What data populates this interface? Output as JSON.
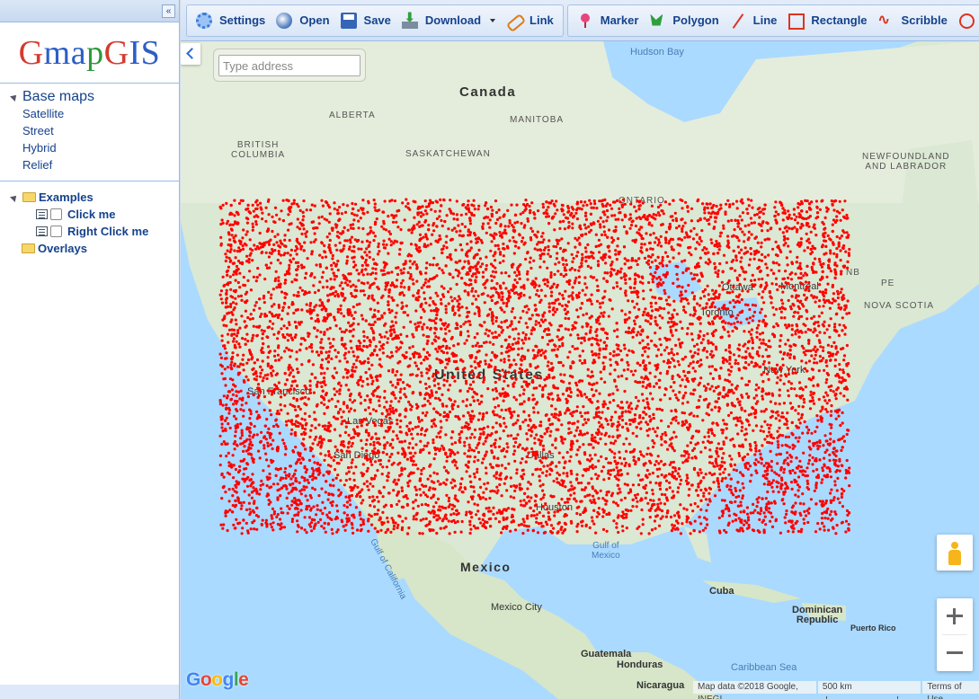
{
  "sidebar": {
    "collapse_label": "«",
    "logo": {
      "g1": "G",
      "m": "m",
      "a": "a",
      "p": "p",
      "g2": "G",
      "i": "I",
      "s": "S"
    },
    "basemaps": {
      "title": "Base maps",
      "items": [
        {
          "label": "Satellite"
        },
        {
          "label": "Street"
        },
        {
          "label": "Hybrid"
        },
        {
          "label": "Relief"
        }
      ]
    },
    "tree": {
      "examples_label": "Examples",
      "children": [
        {
          "label": "Click me"
        },
        {
          "label": "Right Click me"
        }
      ],
      "overlays_label": "Overlays"
    }
  },
  "toolbar": {
    "file_group": [
      {
        "label": "Settings",
        "icon": "gear-icon"
      },
      {
        "label": "Open",
        "icon": "globe-icon"
      },
      {
        "label": "Save",
        "icon": "floppy-icon"
      },
      {
        "label": "Download",
        "icon": "download-icon"
      },
      {
        "label": "Link",
        "icon": "link-icon"
      }
    ],
    "draw_group": [
      {
        "label": "Marker",
        "icon": "pin-icon"
      },
      {
        "label": "Polygon",
        "icon": "polygon-icon"
      },
      {
        "label": "Line",
        "icon": "line-icon"
      },
      {
        "label": "Rectangle",
        "icon": "rectangle-icon"
      },
      {
        "label": "Scribble",
        "icon": "scribble-icon"
      }
    ]
  },
  "map": {
    "search": {
      "placeholder": "Type address"
    },
    "labels": {
      "canada": "Canada",
      "united_states": "United States",
      "mexico": "Mexico",
      "cuba": "Cuba",
      "dominican_republic": "Dominican\nRepublic",
      "puerto_rico": "Puerto Rico",
      "guatemala": "Guatemala",
      "honduras": "Honduras",
      "nicaragua": "Nicaragua",
      "alberta": "ALBERTA",
      "manitoba": "MANITOBA",
      "british_columbia": "BRITISH\nCOLUMBIA",
      "saskatchewan": "SASKATCHEWAN",
      "ontario": "ONTARIO",
      "newfoundland": "NEWFOUNDLAND\nAND LABRADOR",
      "nova_scotia": "NOVA SCOTIA",
      "nb": "NB",
      "pe": "PE",
      "hudson_bay": "Hudson Bay",
      "gulf_of_mexico": "Gulf of\nMexico",
      "caribbean_sea": "Caribbean Sea",
      "gulf_of_california": "Gulf of California",
      "mexico_city": "Mexico City",
      "houston": "Houston",
      "dallas": "Dallas",
      "toronto": "Toronto",
      "ottawa": "Ottawa",
      "montreal": "Montreal",
      "san_francisco": "San Francisco",
      "las_vegas": "Las Vegas",
      "san_diego": "San Diego",
      "new_york": "New York"
    },
    "attribution": {
      "map_data": "Map data ©2018 Google, INEGI",
      "scale": "500 km",
      "terms": "Terms of Use"
    },
    "google_logo": {
      "c1": "G",
      "c2": "o",
      "c3": "o",
      "c4": "g",
      "c5": "l",
      "c6": "e"
    },
    "point_color": "#ff0000"
  }
}
